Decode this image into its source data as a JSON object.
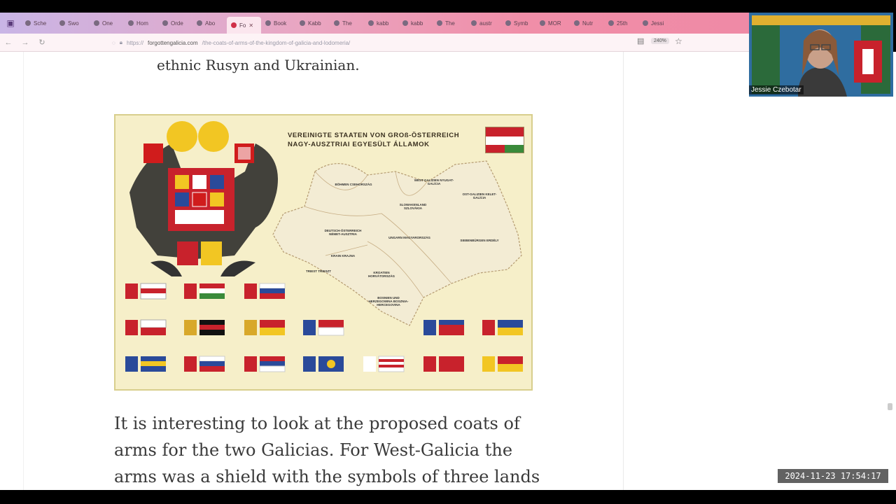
{
  "tabs": [
    {
      "label": "Sche"
    },
    {
      "label": "Swo"
    },
    {
      "label": "One"
    },
    {
      "label": "Hom"
    },
    {
      "label": "Orde"
    },
    {
      "label": "Abo"
    },
    {
      "label": "Fo",
      "active": true
    },
    {
      "label": "Book"
    },
    {
      "label": "Kabb"
    },
    {
      "label": "The"
    },
    {
      "label": "kabb"
    },
    {
      "label": "kabb"
    },
    {
      "label": "The"
    },
    {
      "label": "austr"
    },
    {
      "label": "Symb"
    },
    {
      "label": "MOR"
    },
    {
      "label": "Nutr"
    },
    {
      "label": "25th"
    },
    {
      "label": "Jessi"
    }
  ],
  "address": {
    "domain": "forgottengalicia.com",
    "path": "/the-coats-of-arms-of-the-kingdom-of-galicia-and-lodomeria/",
    "scheme": "https://",
    "zoom": "240%"
  },
  "article": {
    "line_top": "ethnic Rusyn and Ukrainian.",
    "paragraph": [
      "It is interesting to look at the proposed coats of",
      "arms for the two Galicias. For West-Galicia the",
      "arms was a shield with the symbols of three lands"
    ]
  },
  "poster": {
    "title_line1": "VEREINIGTE STAATEN VON GROß-ÖSTERREICH",
    "title_line2": "NAGY-AUSZTRIAI EGYESÜLT ÁLLAMOK",
    "map_labels": [
      "BÖHMEN CSEHORSZÁG",
      "WEST-GALIZIEN NYUGAT-GALÍCIA",
      "OST-GALIZIEN KELET-GALÍCIA",
      "SLOWAKENLAND SZLOVÁKIA",
      "DEUTSCH-ÖSTERREICH NÉMET-AUSZTRIA",
      "UNGARN MAGYARORSZÁG",
      "SIEBENBÜRGEN ERDÉLY",
      "KRAIN KRAJNA",
      "TRIEST TRIESZT",
      "KROATIEN HORVÁTORSZÁG",
      "BOSNIEN UND HERZEGOWINA BOSZNIA-HERCEGOVINA"
    ]
  },
  "webcam": {
    "name": "Jessie Czebotar"
  },
  "timestamp": "2024-11-23  17:54:17",
  "colors": {
    "accent_tab": "#d03048",
    "tab_gradient_end": "#ef8aa6"
  }
}
